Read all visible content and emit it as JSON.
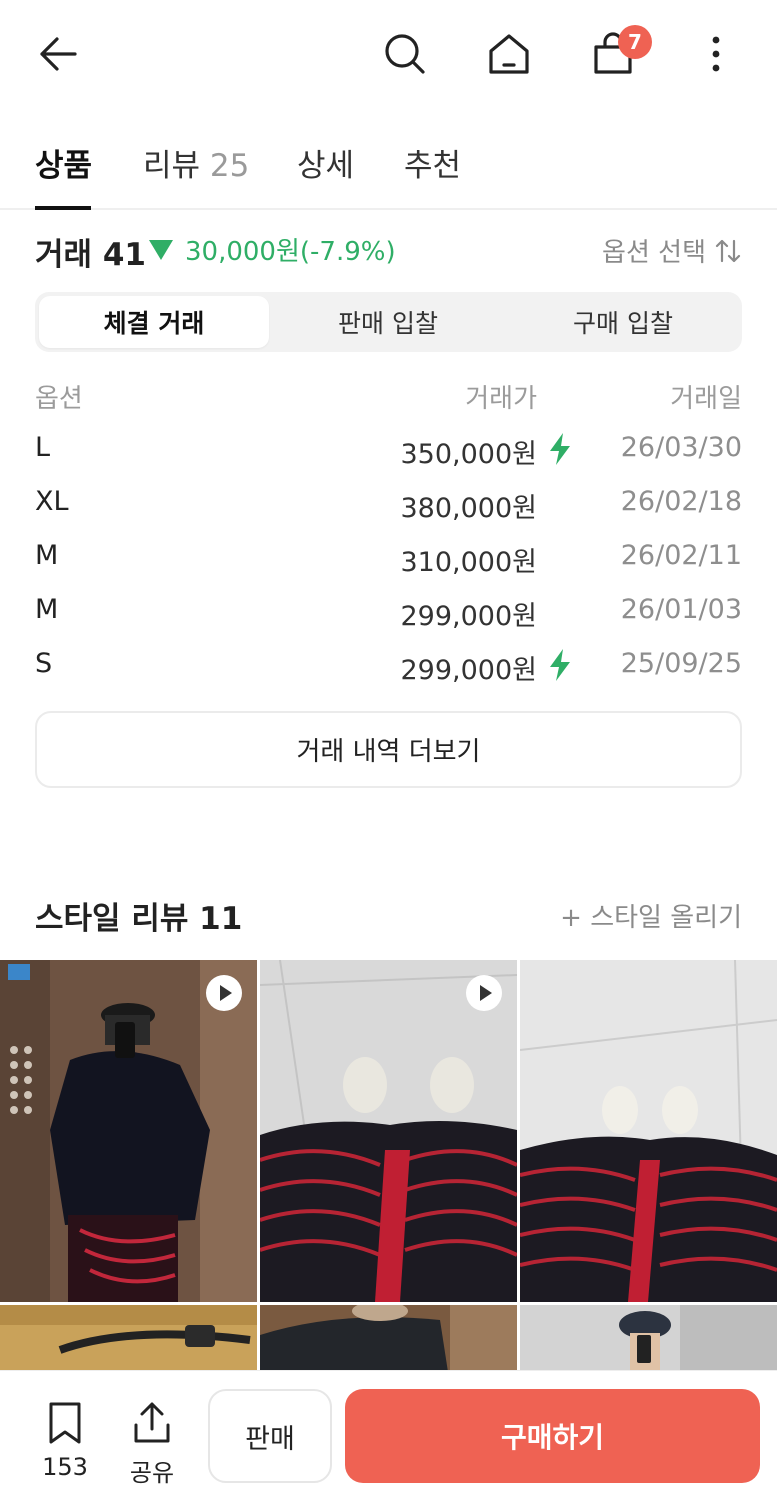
{
  "header": {
    "cart_count": "7",
    "icons": [
      "back-arrow-icon",
      "search-icon",
      "home-icon",
      "shopping-bag-icon",
      "more-vertical-icon"
    ]
  },
  "tabs": {
    "product": "상품",
    "review": "리뷰",
    "review_count": "25",
    "detail": "상세",
    "recommend": "추천"
  },
  "summary": {
    "title": "거래 41",
    "change": "30,000원(-7.9%)",
    "option_select": "옵션 선택"
  },
  "segment": {
    "executed": "체결 거래",
    "sell_bid": "판매 입찰",
    "buy_bid": "구매 입찰"
  },
  "trades": {
    "headers": {
      "option": "옵션",
      "price": "거래가",
      "date": "거래일"
    },
    "rows": [
      {
        "option": "L",
        "price": "350,000원",
        "date": "26/03/30",
        "fast": true
      },
      {
        "option": "XL",
        "price": "380,000원",
        "date": "26/02/18",
        "fast": false
      },
      {
        "option": "M",
        "price": "310,000원",
        "date": "26/02/11",
        "fast": false
      },
      {
        "option": "M",
        "price": "299,000원",
        "date": "26/01/03",
        "fast": false
      },
      {
        "option": "S",
        "price": "299,000원",
        "date": "25/09/25",
        "fast": true
      }
    ],
    "more": "거래 내역 더보기"
  },
  "style_review": {
    "title": "스타일 리뷰 11",
    "upload": "+ 스타일 올리기"
  },
  "bottom": {
    "bookmark_count": "153",
    "share": "공유",
    "sell": "판매",
    "buy": "구매하기"
  },
  "colors": {
    "accent": "#ef6253",
    "down": "#2fae66",
    "fast": "#2fae66"
  }
}
